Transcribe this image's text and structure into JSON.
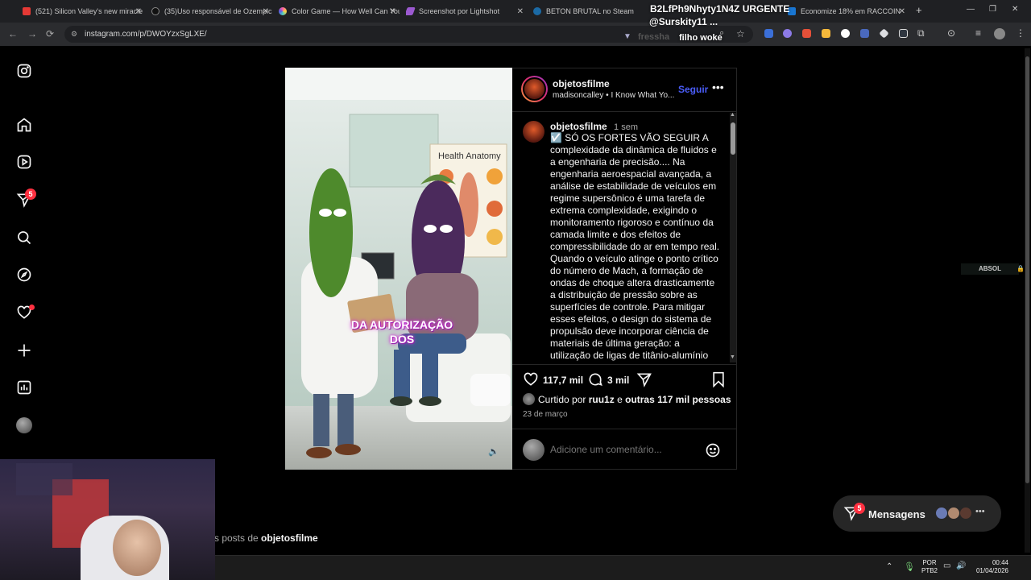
{
  "browser": {
    "tabs": [
      {
        "label": "(521) Silicon Valley's new miracle",
        "color": "#e53935"
      },
      {
        "label": "(35)Uso responsável de Ozempic",
        "color": "#111111"
      },
      {
        "label": "Color Game — How Well Can You",
        "color": "#ff5fa2"
      },
      {
        "label": "Screenshot por Lightshot",
        "color": "#9b59d0"
      },
      {
        "label": "BETON BRUTAL no Steam",
        "color": "#1b6aa5"
      },
      {
        "label": "Economize 18% em RACCOIN",
        "color": "#1976d2"
      }
    ],
    "url": "instagram.com/p/DWOYzxSgLXE/",
    "overlay": {
      "top_text": "B2LfPh9Nhyty1N4Z URGENTE",
      "handle": "@Surskity11 ...",
      "faded_text": "fressha",
      "tag": "filho woke"
    },
    "side_label": "ABSOL"
  },
  "instagram": {
    "notifications_badge": "5",
    "post": {
      "media_caption_line1": "DA AUTORIZAÇÃO",
      "media_caption_line2": "DOS",
      "poster_text": "Health Anatomy",
      "author": "objetosfilme",
      "follow_label": "Seguir",
      "music_user": "madisoncalley",
      "music_track": "I Know What Yo...",
      "comment_author": "objetosfilme",
      "comment_age": "1 sem",
      "caption_text": "☑️ SÓ OS FORTES VÃO SEGUIR A complexidade da dinâmica de fluidos e a engenharia de precisão.... Na engenharia aeroespacial avançada, a análise de estabilidade de veículos em regime supersônico é uma tarefa de extrema complexidade, exigindo o monitoramento rigoroso e contínuo da camada limite e dos efeitos de compressibilidade do ar em tempo real. Quando o veículo atinge o ponto crítico do número de Mach, a formação de ondas de choque altera drasticamente a distribuição de pressão sobre as superfícies de controle. Para mitigar esses efeitos, o design do sistema de propulsão deve incorporar ciência de materiais de última geração: a utilização de ligas de titânio-alumínio",
      "likes": "117,7 mil",
      "comments": "3 mil",
      "liked_by_prefix": "Curtido por",
      "liked_by_user": "ruu1z",
      "liked_by_joiner": "e",
      "liked_by_others": "outras 117 mil pessoas",
      "date": "23 de março",
      "comment_placeholder": "Adicione um comentário..."
    },
    "more_posts_prefix": "s posts de",
    "more_posts_user": "objetosfilme",
    "messages_label": "Mensagens",
    "messages_badge": "5"
  },
  "taskbar": {
    "lang_line1": "POR",
    "lang_line2": "PTB2",
    "time": "00:44",
    "date": "01/04/2026"
  }
}
